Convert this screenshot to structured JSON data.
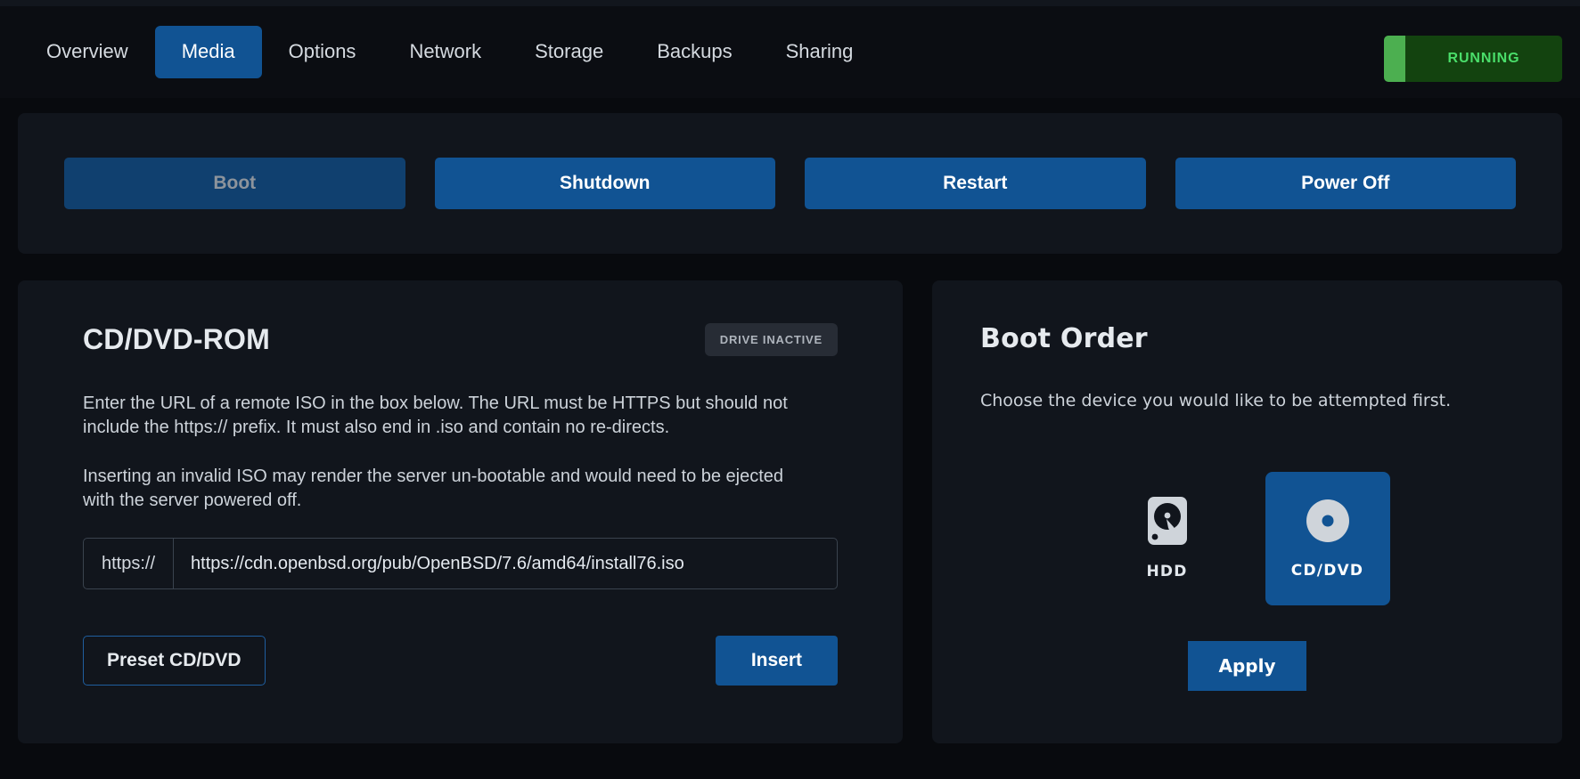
{
  "nav": {
    "tabs": [
      {
        "label": "Overview",
        "active": false
      },
      {
        "label": "Media",
        "active": true
      },
      {
        "label": "Options",
        "active": false
      },
      {
        "label": "Network",
        "active": false
      },
      {
        "label": "Storage",
        "active": false
      },
      {
        "label": "Backups",
        "active": false
      },
      {
        "label": "Sharing",
        "active": false
      }
    ],
    "status": {
      "label": "RUNNING",
      "accent_color": "#4caf50",
      "background_color": "#13430f",
      "text_color": "#4ade6a"
    }
  },
  "power": {
    "buttons": [
      {
        "label": "Boot",
        "disabled": true
      },
      {
        "label": "Shutdown",
        "disabled": false
      },
      {
        "label": "Restart",
        "disabled": false
      },
      {
        "label": "Power Off",
        "disabled": false
      }
    ]
  },
  "cdrom": {
    "title": "CD/DVD-ROM",
    "status_badge": "DRIVE INACTIVE",
    "paragraph_1": "Enter the URL of a remote ISO in the box below. The URL must be HTTPS but should not include the https:// prefix. It must also end in .iso and contain no re-directs.",
    "paragraph_2": "Inserting an invalid ISO may render the server un-bootable and would need to be ejected with the server powered off.",
    "url_prefix": "https://",
    "url_value": "https://cdn.openbsd.org/pub/OpenBSD/7.6/amd64/install76.iso",
    "url_placeholder": "",
    "preset_button": "Preset CD/DVD",
    "insert_button": "Insert"
  },
  "boot_order": {
    "title": "Boot Order",
    "description": "Choose the device you would like to be attempted first.",
    "devices": [
      {
        "label": "HDD",
        "icon": "hard-disk-icon",
        "selected": false
      },
      {
        "label": "CD/DVD",
        "icon": "compact-disc-icon",
        "selected": true
      }
    ],
    "apply_button": "Apply"
  },
  "theme": {
    "page_background": "#080a0e",
    "panel_background": "#11151c",
    "accent_blue": "#115393",
    "disabled_blue": "#10406f"
  }
}
